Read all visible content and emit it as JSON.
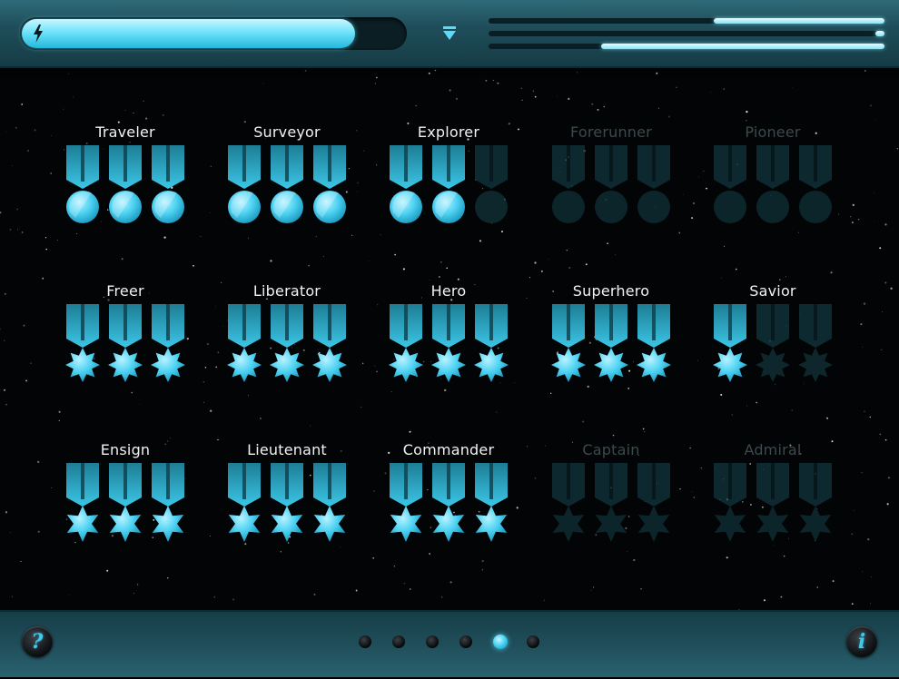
{
  "header": {
    "energy_progress": 0.87,
    "energy_icon": "lightning-bolt-icon",
    "dropdown_icon": "menu-dropdown-icon",
    "stat_bars": [
      0.99,
      0.03,
      0.96
    ]
  },
  "achievement_groups": [
    {
      "name": "Traveler",
      "shape": "circle",
      "earned": 3,
      "total": 3
    },
    {
      "name": "Surveyor",
      "shape": "circle",
      "earned": 3,
      "total": 3
    },
    {
      "name": "Explorer",
      "shape": "circle",
      "earned": 2,
      "total": 3
    },
    {
      "name": "Forerunner",
      "shape": "circle",
      "earned": 0,
      "total": 3
    },
    {
      "name": "Pioneer",
      "shape": "circle",
      "earned": 0,
      "total": 3
    },
    {
      "name": "Freer",
      "shape": "burst",
      "earned": 3,
      "total": 3
    },
    {
      "name": "Liberator",
      "shape": "burst",
      "earned": 3,
      "total": 3
    },
    {
      "name": "Hero",
      "shape": "burst",
      "earned": 3,
      "total": 3
    },
    {
      "name": "Superhero",
      "shape": "burst",
      "earned": 3,
      "total": 3
    },
    {
      "name": "Savior",
      "shape": "burst",
      "earned": 1,
      "total": 3
    },
    {
      "name": "Ensign",
      "shape": "star",
      "earned": 3,
      "total": 3
    },
    {
      "name": "Lieutenant",
      "shape": "star",
      "earned": 3,
      "total": 3
    },
    {
      "name": "Commander",
      "shape": "star",
      "earned": 3,
      "total": 3
    },
    {
      "name": "Captain",
      "shape": "star",
      "earned": 0,
      "total": 3
    },
    {
      "name": "Admiral",
      "shape": "star",
      "earned": 0,
      "total": 3
    }
  ],
  "footer": {
    "help_label": "?",
    "info_label": "i",
    "page_count": 6,
    "current_page": 5
  },
  "colors": {
    "accent": "#3fd0f2",
    "panel": "#1f4e5a",
    "locked_text": "#3c4a4e"
  }
}
